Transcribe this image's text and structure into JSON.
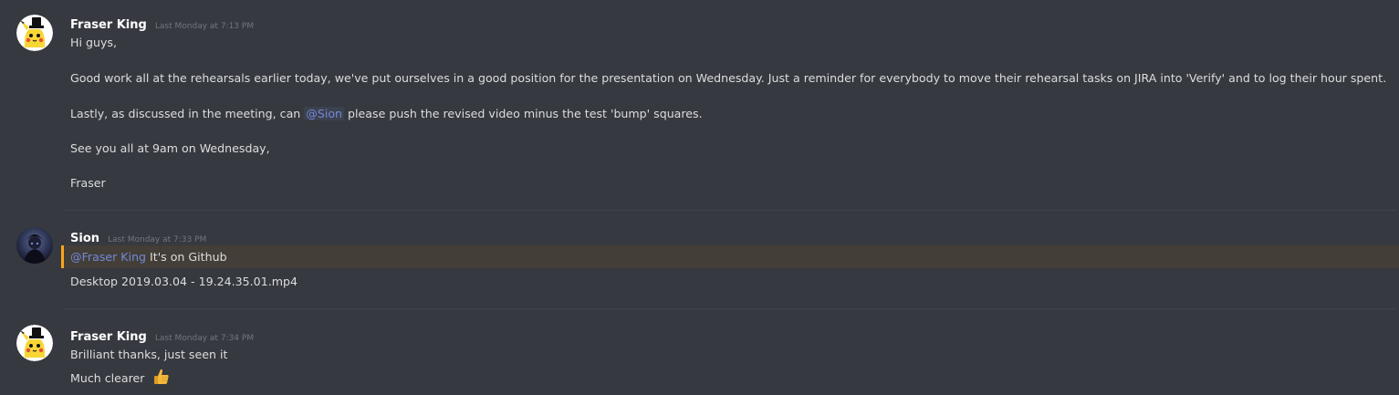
{
  "colors": {
    "background": "#36393f",
    "username": "#ffffff",
    "mention": "#7289da",
    "mention_highlight_border": "#faa61a",
    "timestamp": "#72767d"
  },
  "messages": [
    {
      "author": "Fraser King",
      "timestamp": "Last Monday at 7:13 PM",
      "avatar_icon": "pikachu-tophat-avatar",
      "lines": {
        "l1": "Hi guys,",
        "l2": "Good work all at the rehearsals earlier today, we've put ourselves in a good position for the presentation on Wednesday. Just a reminder for everybody to move their rehearsal tasks on JIRA into 'Verify' and to log their hour spent.",
        "l3_before": "Lastly, as discussed in the meeting, can ",
        "l3_mention": "@Sion",
        "l3_after": " please push the revised video minus the test 'bump' squares.",
        "l4": "See you all at 9am on Wednesday,",
        "l5": "Fraser"
      }
    },
    {
      "author": "Sion",
      "timestamp": "Last Monday at 7:33 PM",
      "avatar_icon": "dark-character-avatar",
      "lines": {
        "l1_mention": "@Fraser King",
        "l1_after": " It's on Github",
        "l2": "Desktop 2019.03.04 - 19.24.35.01.mp4"
      }
    },
    {
      "author": "Fraser King",
      "timestamp": "Last Monday at 7:34 PM",
      "avatar_icon": "pikachu-tophat-avatar",
      "lines": {
        "l1": "Brilliant thanks, just seen it",
        "l2": "Much clearer",
        "emoji": "thumbs-up-icon"
      }
    }
  ]
}
